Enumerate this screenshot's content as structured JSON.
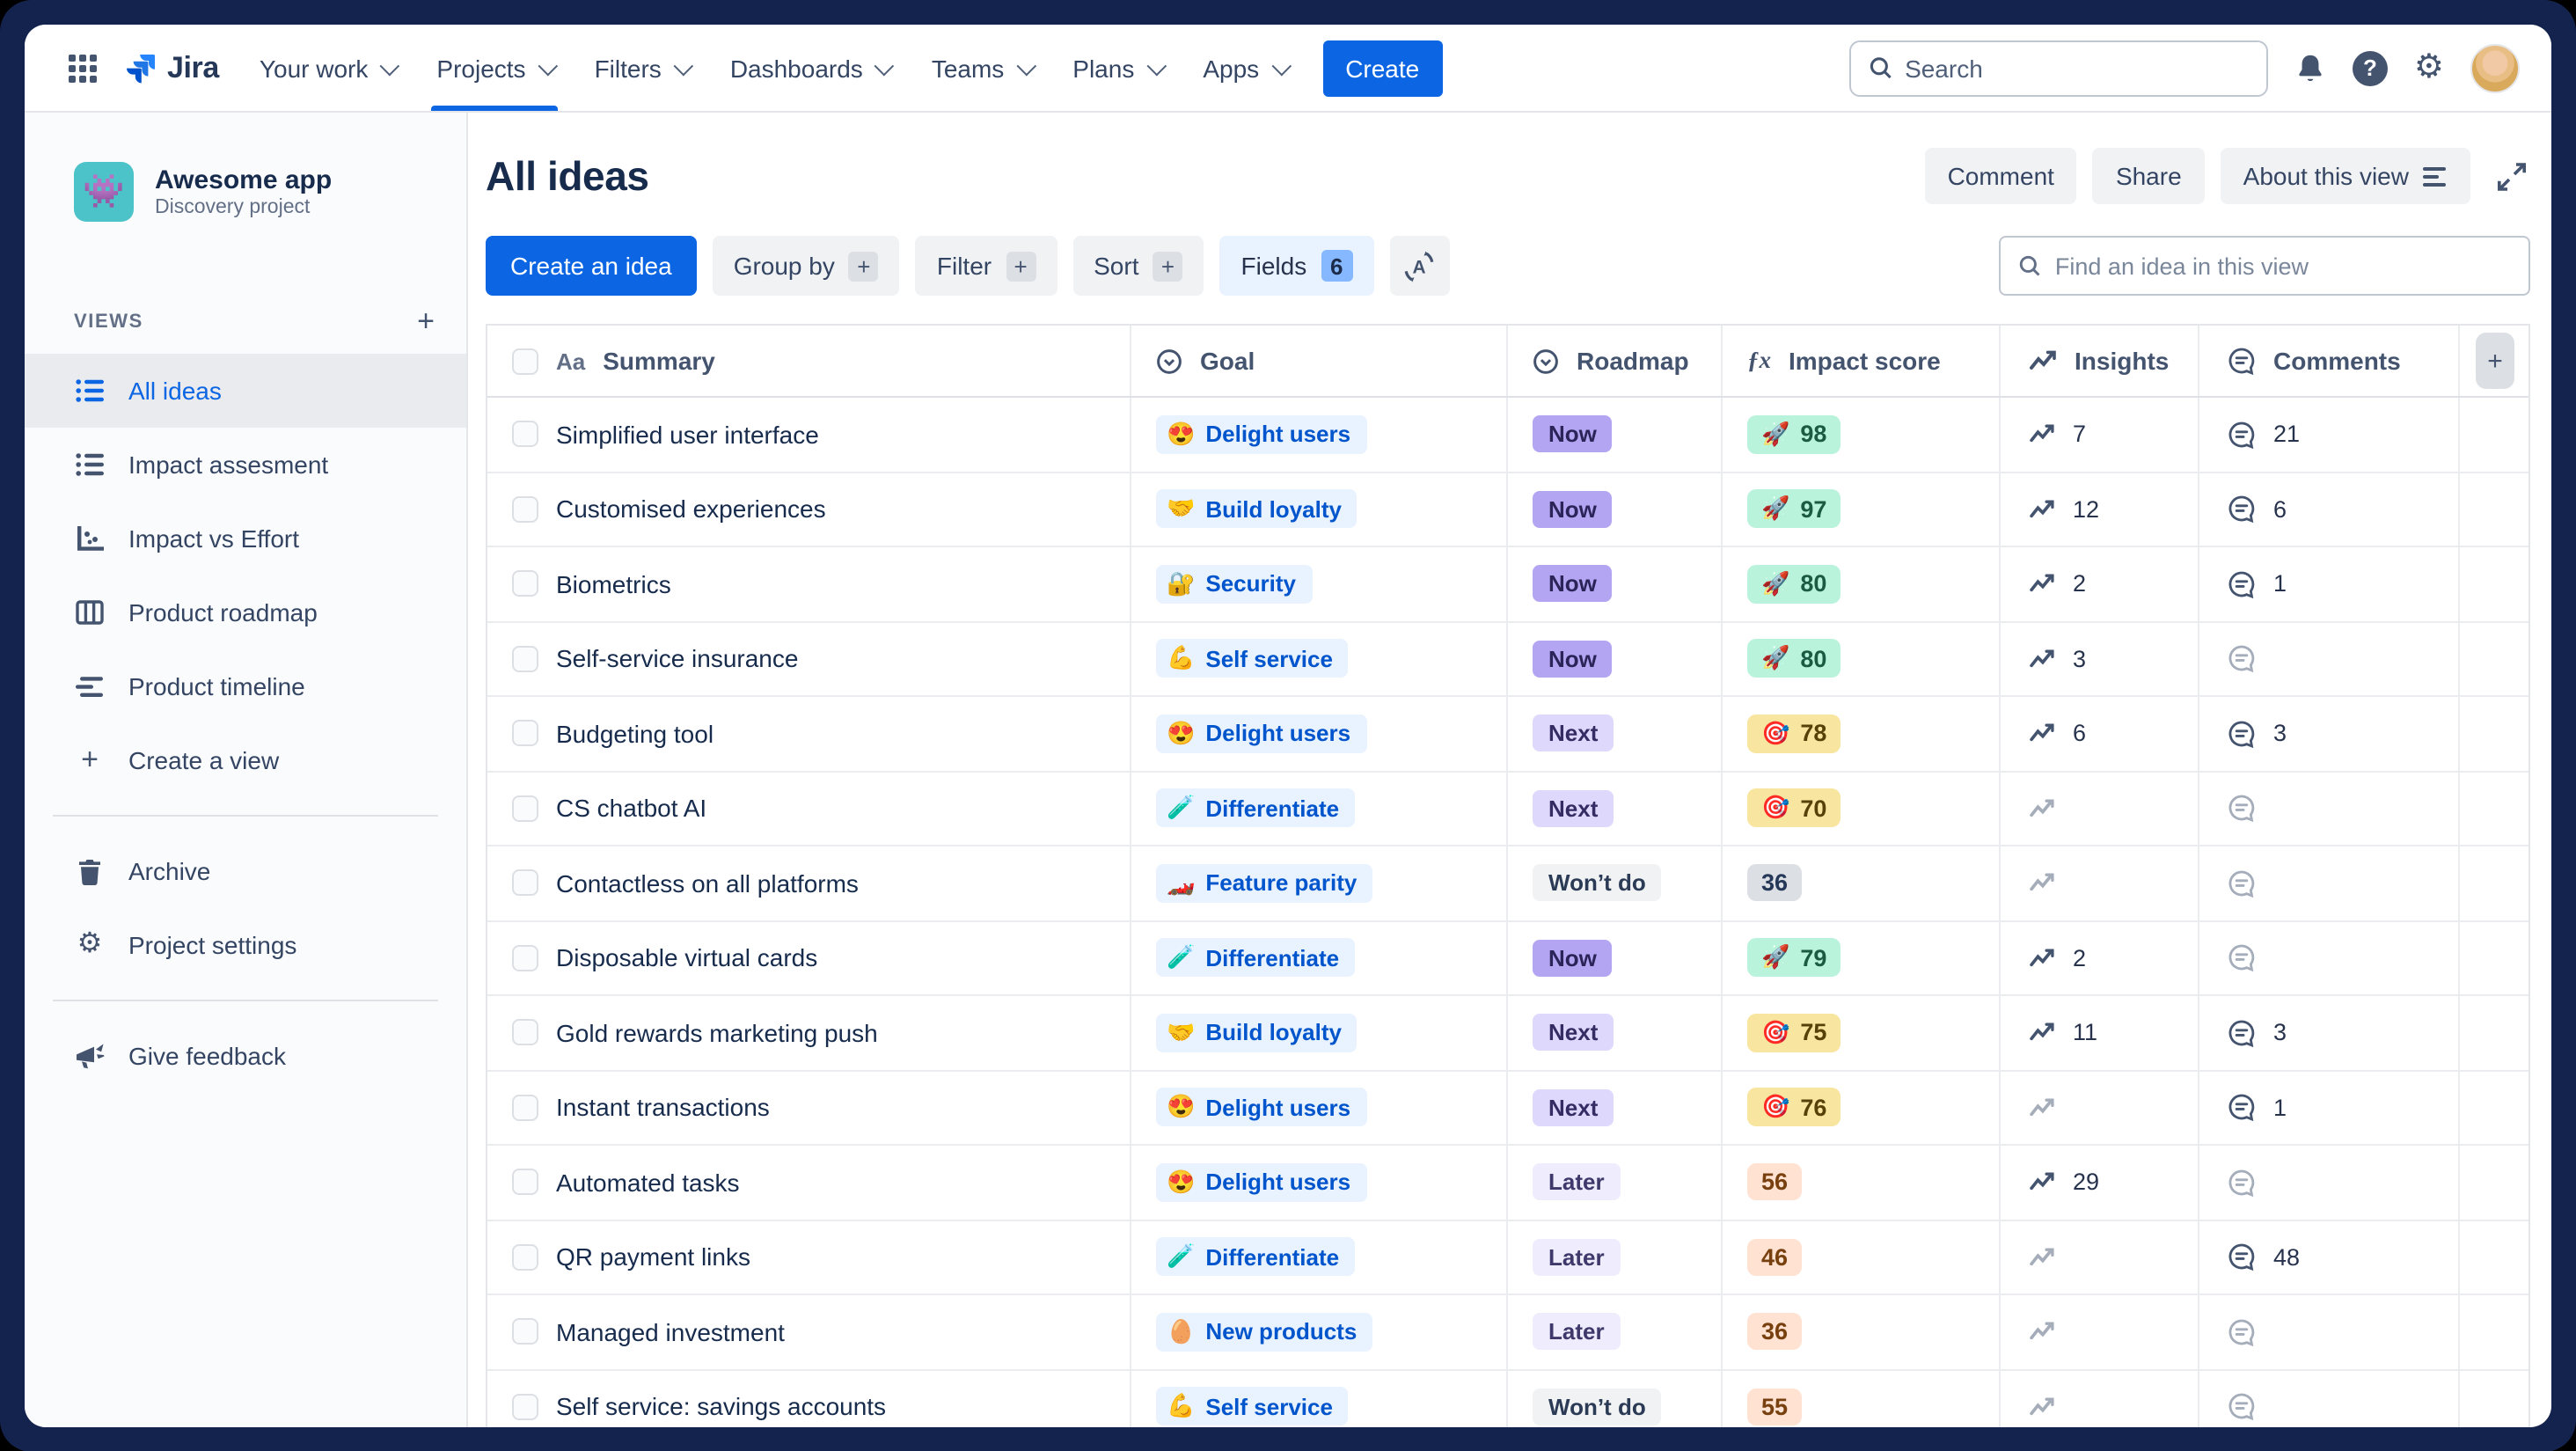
{
  "nav": {
    "logo_text": "Jira",
    "menu": [
      "Your work",
      "Projects",
      "Filters",
      "Dashboards",
      "Teams",
      "Plans",
      "Apps"
    ],
    "active_menu": "Projects",
    "create_label": "Create",
    "search_placeholder": "Search"
  },
  "sidebar": {
    "project": {
      "name": "Awesome app",
      "type": "Discovery project",
      "icon_emoji": "👾"
    },
    "views_label": "VIEWS",
    "views": [
      {
        "label": "All ideas",
        "icon": "list-icon",
        "active": true
      },
      {
        "label": "Impact assesment",
        "icon": "list-icon"
      },
      {
        "label": "Impact vs Effort",
        "icon": "scatter-chart-icon"
      },
      {
        "label": "Product roadmap",
        "icon": "board-columns-icon"
      },
      {
        "label": "Product timeline",
        "icon": "timeline-icon"
      },
      {
        "label": "Create a view",
        "icon": "plus-icon"
      }
    ],
    "footer": [
      {
        "label": "Archive",
        "icon": "trash-icon"
      },
      {
        "label": "Project settings",
        "icon": "gear-icon"
      }
    ],
    "feedback_label": "Give feedback"
  },
  "header": {
    "title": "All ideas",
    "comment_label": "Comment",
    "share_label": "Share",
    "about_label": "About this view"
  },
  "toolbar": {
    "create_idea": "Create an idea",
    "group_by": "Group by",
    "filter": "Filter",
    "sort": "Sort",
    "fields": "Fields",
    "fields_count": "6",
    "find_placeholder": "Find an idea in this view"
  },
  "table": {
    "columns": [
      "Summary",
      "Goal",
      "Roadmap",
      "Impact score",
      "Insights",
      "Comments"
    ],
    "rows": [
      {
        "summary": "Simplified user interface",
        "goal_emoji": "😍",
        "goal": "Delight users",
        "roadmap": "Now",
        "roadmap_style": "now",
        "impact": "98",
        "impact_emoji": "🚀",
        "impact_style": "green",
        "insights": "7",
        "comments": "21"
      },
      {
        "summary": "Customised experiences",
        "goal_emoji": "🤝",
        "goal": "Build loyalty",
        "roadmap": "Now",
        "roadmap_style": "now",
        "impact": "97",
        "impact_emoji": "🚀",
        "impact_style": "green",
        "insights": "12",
        "comments": "6"
      },
      {
        "summary": "Biometrics",
        "goal_emoji": "🔐",
        "goal": "Security",
        "roadmap": "Now",
        "roadmap_style": "now",
        "impact": "80",
        "impact_emoji": "🚀",
        "impact_style": "green",
        "insights": "2",
        "comments": "1"
      },
      {
        "summary": "Self-service insurance",
        "goal_emoji": "💪",
        "goal": "Self service",
        "roadmap": "Now",
        "roadmap_style": "now",
        "impact": "80",
        "impact_emoji": "🚀",
        "impact_style": "green",
        "insights": "3",
        "comments": ""
      },
      {
        "summary": "Budgeting tool",
        "goal_emoji": "😍",
        "goal": "Delight users",
        "roadmap": "Next",
        "roadmap_style": "next",
        "impact": "78",
        "impact_emoji": "🎯",
        "impact_style": "yellow",
        "insights": "6",
        "comments": "3"
      },
      {
        "summary": "CS chatbot AI",
        "goal_emoji": "🧪",
        "goal": "Differentiate",
        "roadmap": "Next",
        "roadmap_style": "next",
        "impact": "70",
        "impact_emoji": "🎯",
        "impact_style": "yellow",
        "insights": "",
        "comments": ""
      },
      {
        "summary": "Contactless on all platforms",
        "goal_emoji": "🏎️",
        "goal": "Feature parity",
        "roadmap": "Won’t do",
        "roadmap_style": "wont",
        "impact": "36",
        "impact_emoji": "",
        "impact_style": "gray",
        "insights": "",
        "comments": ""
      },
      {
        "summary": "Disposable virtual cards",
        "goal_emoji": "🧪",
        "goal": "Differentiate",
        "roadmap": "Now",
        "roadmap_style": "now",
        "impact": "79",
        "impact_emoji": "🚀",
        "impact_style": "green",
        "insights": "2",
        "comments": ""
      },
      {
        "summary": "Gold rewards marketing push",
        "goal_emoji": "🤝",
        "goal": "Build loyalty",
        "roadmap": "Next",
        "roadmap_style": "next",
        "impact": "75",
        "impact_emoji": "🎯",
        "impact_style": "yellow",
        "insights": "11",
        "comments": "3"
      },
      {
        "summary": "Instant transactions",
        "goal_emoji": "😍",
        "goal": "Delight users",
        "roadmap": "Next",
        "roadmap_style": "next",
        "impact": "76",
        "impact_emoji": "🎯",
        "impact_style": "yellow",
        "insights": "",
        "comments": "1"
      },
      {
        "summary": "Automated tasks",
        "goal_emoji": "😍",
        "goal": "Delight users",
        "roadmap": "Later",
        "roadmap_style": "later",
        "impact": "56",
        "impact_emoji": "",
        "impact_style": "peach",
        "insights": "29",
        "comments": ""
      },
      {
        "summary": "QR payment links",
        "goal_emoji": "🧪",
        "goal": "Differentiate",
        "roadmap": "Later",
        "roadmap_style": "later",
        "impact": "46",
        "impact_emoji": "",
        "impact_style": "peach",
        "insights": "",
        "comments": "48"
      },
      {
        "summary": "Managed investment",
        "goal_emoji": "🥚",
        "goal": "New products",
        "roadmap": "Later",
        "roadmap_style": "later",
        "impact": "36",
        "impact_emoji": "",
        "impact_style": "peach",
        "insights": "",
        "comments": ""
      },
      {
        "summary": "Self service: savings accounts",
        "goal_emoji": "💪",
        "goal": "Self service",
        "roadmap": "Won’t do",
        "roadmap_style": "wont",
        "impact": "55",
        "impact_emoji": "",
        "impact_style": "peach",
        "insights": "",
        "comments": ""
      }
    ]
  },
  "colors": {
    "accent_blue": "#0C66E4",
    "goal_badge_bg": "#E9F2FF",
    "goal_badge_text": "#0055CC",
    "roadmap_now_bg": "#B3A5F2",
    "roadmap_next_bg": "#DFD8FD",
    "roadmap_later_bg": "#EFEDFD",
    "roadmap_wont_bg": "#F1F2F4",
    "impact_green_bg": "#BAF3DB",
    "impact_yellow_bg": "#F8E6A0",
    "impact_peach_bg": "#FFE2D2",
    "impact_gray_bg": "#DCDFE4",
    "frame_navy": "#14234E"
  }
}
